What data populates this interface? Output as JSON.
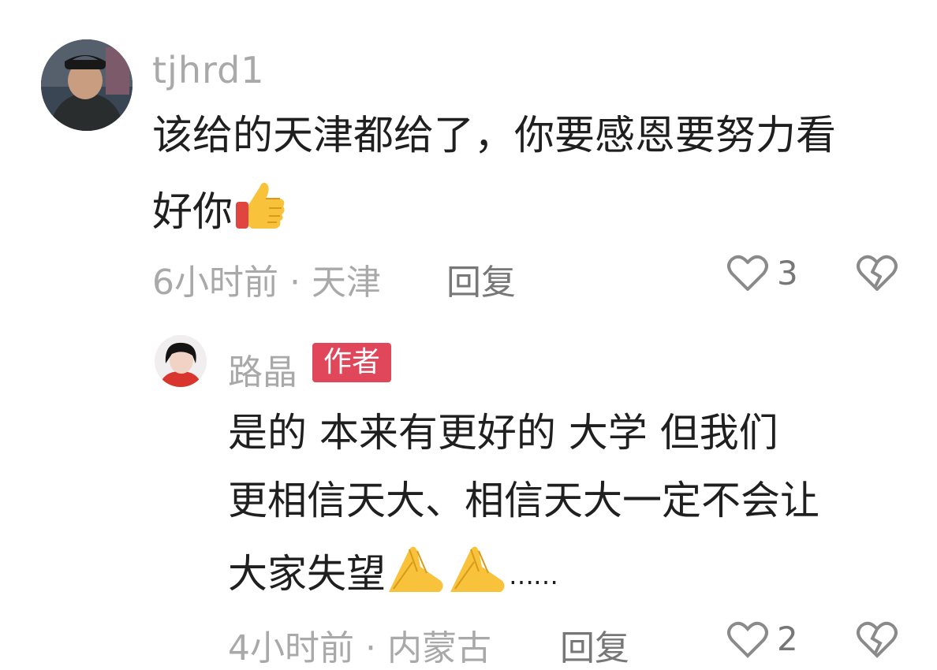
{
  "comment": {
    "username": "tjhrd1",
    "text_line1": "该给的天津都给了，你要感恩要努力看",
    "text_line2": "好你",
    "time": "6小时前",
    "separator": "·",
    "location": "天津",
    "reply_label": "回复",
    "like_count": "3",
    "emoji": "thumbs-up-icon"
  },
  "reply": {
    "username": "路晶",
    "badge": "作者",
    "text_line1": "是的  本来有更好的 大学   但我们",
    "text_line2": "更相信天大、相信天大一定不会让",
    "text_line3": "大家失望",
    "text_tail": "……",
    "time": "4小时前",
    "separator": "·",
    "location": "内蒙古",
    "reply_label": "回复",
    "like_count": "2",
    "emoji": "praying-hands-icon"
  },
  "colors": {
    "badge": "#e0475a",
    "text": "#1f1f1f",
    "meta": "#a9a9a9"
  }
}
